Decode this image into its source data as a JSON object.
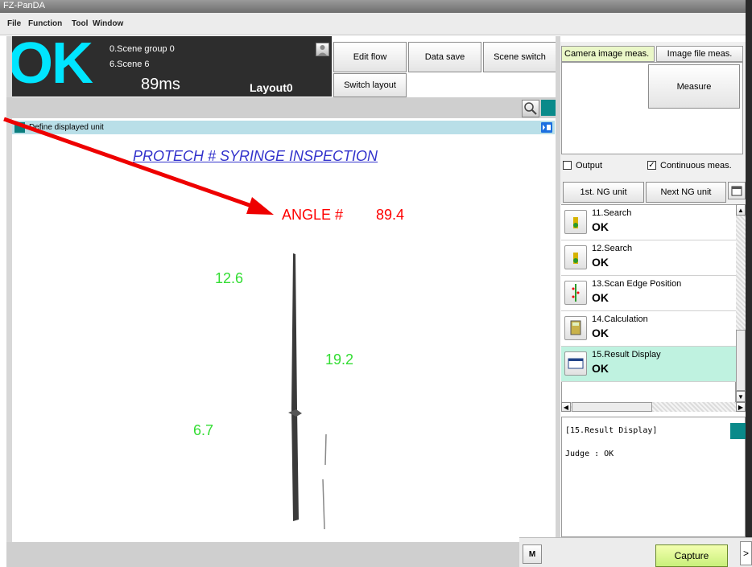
{
  "window": {
    "title": "FZ-PanDA"
  },
  "menu": [
    "File",
    "Function",
    "Tool",
    "Window"
  ],
  "status": {
    "judge": "OK",
    "scene_group": "0.Scene group 0",
    "scene": "6.Scene 6",
    "time": "89ms",
    "layout": "Layout0"
  },
  "toolbar": {
    "edit_flow": "Edit flow",
    "data_save": "Data save",
    "scene_switch": "Scene switch",
    "switch_layout": "Switch layout"
  },
  "image_panel": {
    "define_unit_label": "Define displayed unit",
    "title": "PROTECH # SYRINGE INSPECTION",
    "angle_label": "ANGLE #",
    "angle_value": "89.4",
    "values": [
      "12.6",
      "19.2",
      "6.7"
    ]
  },
  "measure_panel": {
    "tab_camera": "Camera image meas.",
    "tab_file": "Image file meas.",
    "measure": "Measure",
    "output": "Output",
    "continuous": "Continuous meas.",
    "output_checked": false,
    "continuous_checked": true
  },
  "ng_nav": {
    "first": "1st. NG unit",
    "next": "Next NG unit"
  },
  "flow_units": [
    {
      "name": "11.Search",
      "result": "OK",
      "icon": "search-unit-icon"
    },
    {
      "name": "12.Search",
      "result": "OK",
      "icon": "search-unit-icon"
    },
    {
      "name": "13.Scan Edge Position",
      "result": "OK",
      "icon": "scan-edge-icon"
    },
    {
      "name": "14.Calculation",
      "result": "OK",
      "icon": "calculator-icon"
    },
    {
      "name": "15.Result Display",
      "result": "OK",
      "icon": "result-display-icon"
    }
  ],
  "detail": {
    "header": "[15.Result Display]",
    "line": "Judge : OK"
  },
  "bottom": {
    "m": "M",
    "capture": "Capture",
    "arrow": ">"
  },
  "colors": {
    "ok": "#00e5ff",
    "angle": "#ff0000",
    "value": "#33dd33",
    "title": "#3333cc",
    "selected": "#bff2e0"
  }
}
